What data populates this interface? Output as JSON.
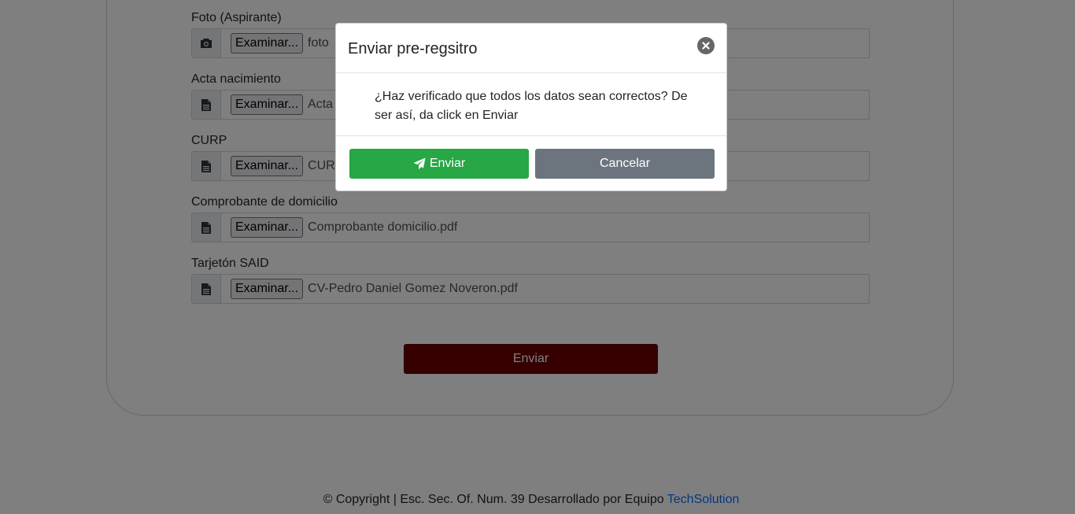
{
  "form": {
    "fields": [
      {
        "label": "Foto (Aspirante)",
        "browse": "Examinar...",
        "file": "foto",
        "icon": "camera-icon"
      },
      {
        "label": "Acta nacimiento",
        "browse": "Examinar...",
        "file": "Acta",
        "icon": "file-icon"
      },
      {
        "label": "CURP",
        "browse": "Examinar...",
        "file": "CURP",
        "icon": "file-icon"
      },
      {
        "label": "Comprobante de domicilio",
        "browse": "Examinar...",
        "file": "Comprobante domicilio.pdf",
        "icon": "file-icon"
      },
      {
        "label": "Tarjetón SAID",
        "browse": "Examinar...",
        "file": "CV-Pedro Daniel Gomez Noveron.pdf",
        "icon": "file-icon"
      }
    ],
    "submit_label": "Enviar"
  },
  "footer": {
    "text": "© Copyright | Esc. Sec. Of. Num. 39 Desarrollado por Equipo ",
    "link": "TechSolution"
  },
  "modal": {
    "title": "Enviar pre-regsitro",
    "message": "¿Haz verificado que todos los datos sean correctos? De ser así, da click en Enviar",
    "confirm_label": "Enviar",
    "cancel_label": "Cancelar"
  },
  "colors": {
    "confirm": "#28a745",
    "cancel": "#6c757d",
    "submit": "#6e0000",
    "link": "#0d6efd"
  }
}
